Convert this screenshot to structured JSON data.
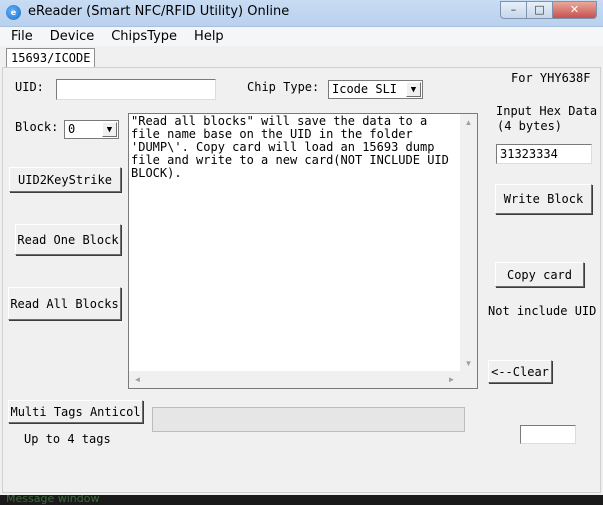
{
  "window": {
    "title": "eReader (Smart NFC/RFID Utility) Online",
    "icon": "app-nfc-icon",
    "min_label": "–",
    "max_label": "□",
    "close_label": "✕"
  },
  "menu": [
    "File",
    "Device",
    "ChipsType",
    "Help"
  ],
  "tab": {
    "label": "15693/ICODE"
  },
  "uid": {
    "label": "UID:",
    "value": ""
  },
  "chip_type": {
    "label": "Chip Type:",
    "selected": "Icode SLI"
  },
  "device_label": "For YHY638F",
  "block": {
    "label": "Block:",
    "selected": "0"
  },
  "input_hex": {
    "label_line1": "Input Hex Data",
    "label_line2": "(4 bytes)",
    "value": "31323334"
  },
  "memo": {
    "text": "\"Read all blocks\" will save the data to a file name base on the UID in the folder 'DUMP\\'. Copy card will load an 15693 dump file and write to a new card(NOT INCLUDE UID BLOCK)."
  },
  "buttons": {
    "uid2keystrike": "UID2KeyStrike",
    "read_one": "Read One Block",
    "read_all": "Read All Blocks",
    "write_block": "Write Block",
    "copy_card": "Copy card",
    "clear": "<--Clear",
    "multi_tags": "Multi Tags Anticol"
  },
  "not_include_uid": "Not include UID",
  "up_to_tags": "Up to 4 tags",
  "small_field_value": "",
  "status_text": "Message window",
  "arrow_glyphs": {
    "down": "▼",
    "up": "▲",
    "left": "◄",
    "right": "►"
  }
}
